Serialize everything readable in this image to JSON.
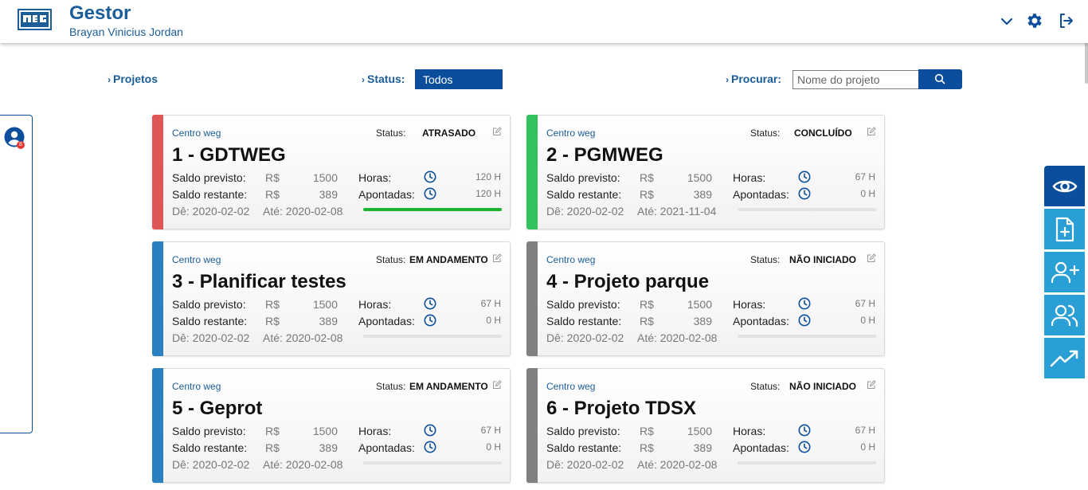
{
  "header": {
    "app_title": "Gestor",
    "user_name": "Brayan Vinicius Jordan",
    "logo_text": "WEG",
    "icons": [
      "chevron-down-icon",
      "gear-icon",
      "logout-icon"
    ]
  },
  "filters": {
    "projects_label": "Projetos",
    "status_label": "Status:",
    "status_value": "Todos",
    "search_label": "Procurar:",
    "search_placeholder": "Nome do projeto"
  },
  "side_panel": {
    "icon": "user-circle-icon",
    "badge": "8"
  },
  "dock": [
    "eye-icon",
    "file-plus-icon",
    "user-plus-icon",
    "users-icon",
    "trending-up-icon"
  ],
  "labels": {
    "status": "Status:",
    "saldo_previsto": "Saldo previsto:",
    "saldo_restante": "Saldo restante:",
    "horas": "Horas:",
    "apontadas": "Apontadas:",
    "currency": "R$"
  },
  "colors": {
    "primary": "#0b4f9c",
    "accent": "#2a9fd6",
    "late": "#e05555",
    "done": "#33c15e",
    "progress": "#2a7fc0",
    "not_started": "#808080",
    "bar_fill": "#1db32e"
  },
  "projects": [
    {
      "center": "Centro weg",
      "status": "ATRASADO",
      "title": "1 - GDTWEG",
      "saldo_previsto": "1500",
      "saldo_restante": "389",
      "horas": "120 H",
      "apontadas": "120 H",
      "de": "Dê: 2020-02-02",
      "ate": "Até: 2020-02-08",
      "progress": 1.0,
      "stripe": "#e05555"
    },
    {
      "center": "Centro weg",
      "status": "CONCLUÍDO",
      "title": "2 - PGMWEG",
      "saldo_previsto": "1500",
      "saldo_restante": "389",
      "horas": "67 H",
      "apontadas": "0 H",
      "de": "Dê: 2020-02-02",
      "ate": "Até: 2021-11-04",
      "progress": 0,
      "stripe": "#33c15e"
    },
    {
      "center": "Centro weg",
      "status": "EM ANDAMENTO",
      "title": "3 - Planificar testes",
      "saldo_previsto": "1500",
      "saldo_restante": "389",
      "horas": "67 H",
      "apontadas": "0 H",
      "de": "Dê: 2020-02-02",
      "ate": "Até: 2020-02-08",
      "progress": 0,
      "stripe": "#2a7fc0"
    },
    {
      "center": "Centro weg",
      "status": "NÃO INICIADO",
      "title": "4 - Projeto parque",
      "saldo_previsto": "1500",
      "saldo_restante": "389",
      "horas": "67 H",
      "apontadas": "0 H",
      "de": "Dê: 2020-02-02",
      "ate": "Até: 2020-02-08",
      "progress": 0,
      "stripe": "#808080"
    },
    {
      "center": "Centro weg",
      "status": "EM ANDAMENTO",
      "title": "5 - Geprot",
      "saldo_previsto": "1500",
      "saldo_restante": "389",
      "horas": "67 H",
      "apontadas": "0 H",
      "de": "Dê: 2020-02-02",
      "ate": "Até: 2020-02-08",
      "progress": 0,
      "stripe": "#2a7fc0"
    },
    {
      "center": "Centro weg",
      "status": "NÃO INICIADO",
      "title": "6 - Projeto TDSX",
      "saldo_previsto": "1500",
      "saldo_restante": "389",
      "horas": "67 H",
      "apontadas": "0 H",
      "de": "Dê: 2020-02-02",
      "ate": "Até: 2020-02-08",
      "progress": 0,
      "stripe": "#808080"
    }
  ]
}
